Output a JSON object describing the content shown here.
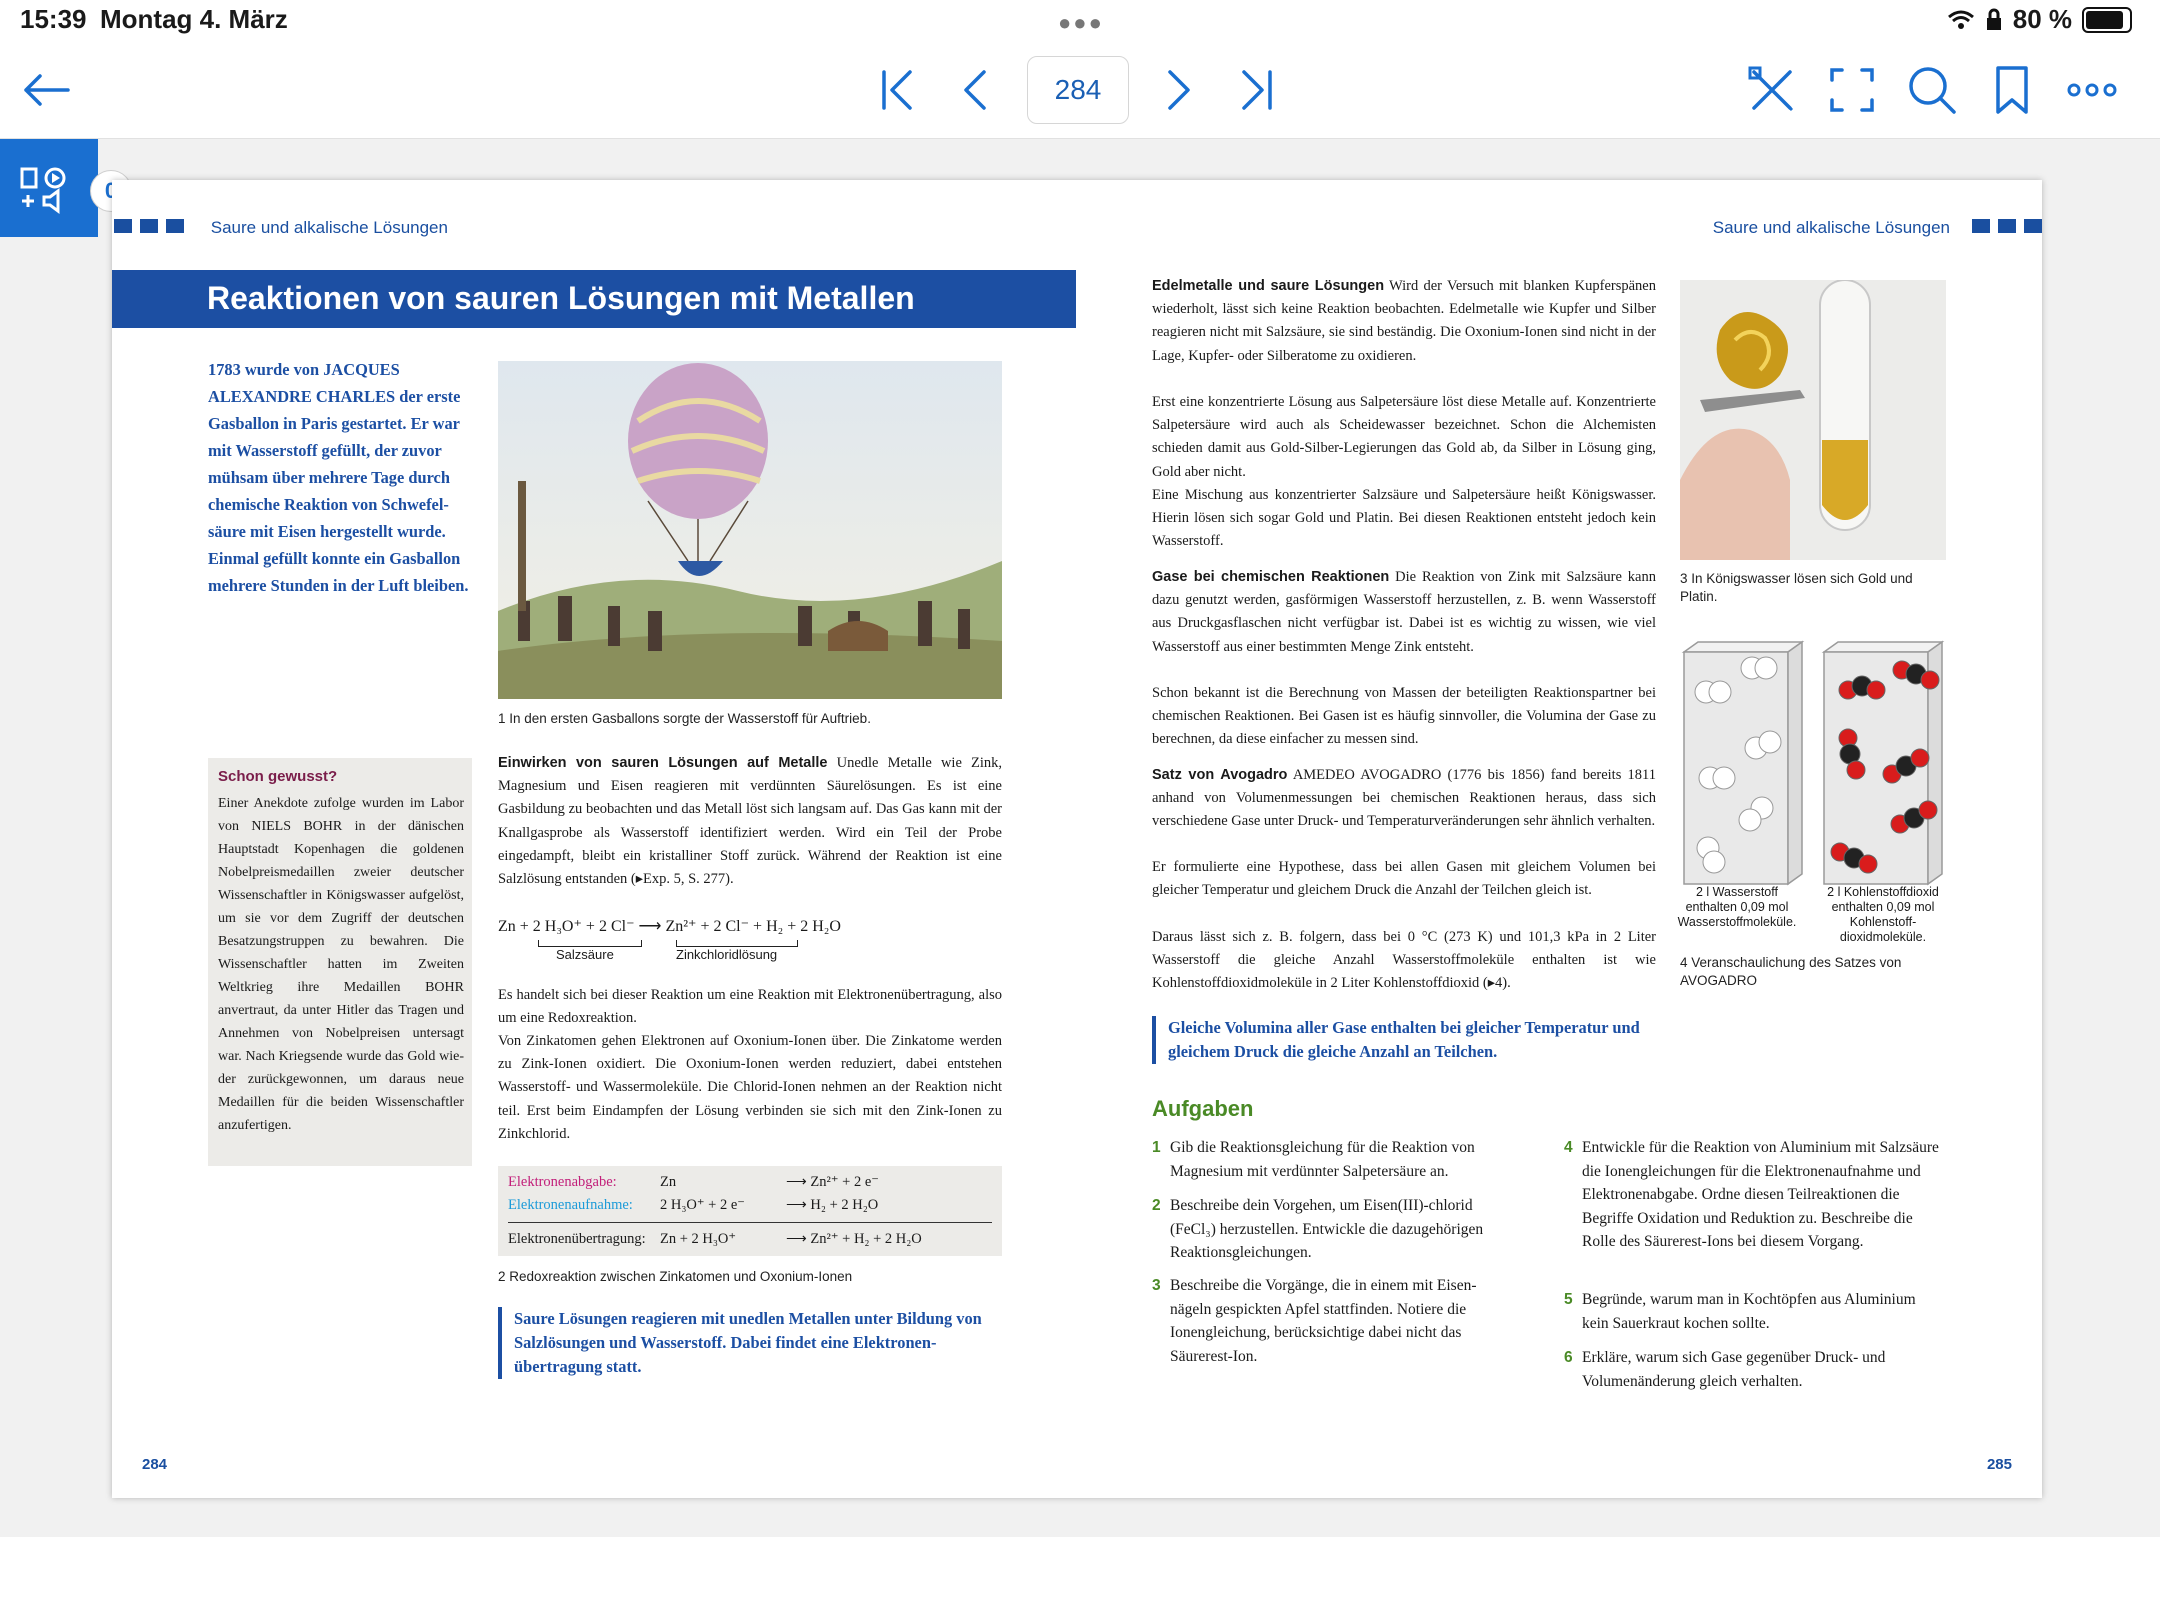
{
  "status_bar": {
    "time": "15:39",
    "date": "Montag 4. März",
    "battery": "80 %"
  },
  "toolbar": {
    "page_number": "284",
    "icons": [
      "back-arrow-icon",
      "first-page-icon",
      "prev-page-icon",
      "next-page-icon",
      "last-page-icon",
      "tools-icon",
      "fullscreen-icon",
      "search-icon",
      "bookmark-icon",
      "more-icon"
    ]
  },
  "media": {
    "counter": "0"
  },
  "left_page": {
    "running_head": "Saure und alkalische Lösungen",
    "title": "Reaktionen von sauren Lösungen mit Metallen",
    "intro": "1783 wurde von JACQUES ALEXANDRE CHARLES der erste Gasballon in Paris gestartet. Er war mit Wasserstoff gefüllt, der zuvor mühsam über mehrere Tage durch chemische Reaktion von Schwefel­säure mit Eisen hergestellt wurde. Einmal gefüllt konnte ein Gas­ballon mehrere Stunden in der Luft bleiben.",
    "know_box": {
      "heading": "Schon gewusst?",
      "text": "Einer Anekdote zufolge wurden im Labor von NIELS BOHR in der däni­schen Hauptstadt Kopenhagen die goldenen Nobelpreismedaillen zweier deutscher Wissenschaftler in Königs­wasser aufgelöst, um sie vor dem Zugriff der deutschen Besatzungs­truppen zu bewahren. Die Wissen­schaftler hatten im Zweiten Weltkrieg ihre Medaillen BOHR anvertraut, da unter Hitler das Tragen und Anneh­men von Nobelpreisen untersagt war. Nach Kriegsende wurde das Gold wie­der zurückgewonnen, um daraus neue Medaillen für die beiden Wissen­schaftler anzufertigen."
    },
    "fig1_caption": "1  In den ersten Gasballons sorgte der Wasserstoff für Auftrieb.",
    "section1_heading": "Einwirken von sauren Lösungen auf Metalle",
    "section1_text": "Unedle Metalle wie Zink, Magnesium und Eisen reagieren mit verdünnten Säurelösungen. Es ist eine Gasbildung zu beobachten und das Metall löst sich langsam auf. Das Gas kann mit der Knallgasprobe als Wasserstoff identifiziert werden. Wird ein Teil der Probe eingedampft, bleibt ein kristalliner Stoff zurück. Während der Reaktion ist eine Salzlösung entstanden (▸Exp. 5, S. 277).",
    "equation": "Zn + 2 H₃O⁺ + 2 Cl⁻ ⟶ Zn²⁺ + 2 Cl⁻ + H₂ + 2 H₂O",
    "eq_label1": "Salzsäure",
    "eq_label2": "Zinkchloridlösung",
    "section1_text2": "Es handelt sich bei dieser Reaktion um eine Reaktion mit Elektronen­übertragung, also um eine Redoxreaktion.",
    "section1_text3": "Von Zinkatomen gehen Elektronen auf Oxonium-Ionen über. Die Zink­atome werden zu Zink-Ionen oxidiert. Die Oxonium-Ionen werden re­duziert, dabei entstehen Wasserstoff- und Wassermoleküle. Die Chlorid-Ionen nehmen an der Reaktion nicht teil. Erst beim Eindampfen der Lösung verbinden sie sich mit den Zink-Ionen zu Zinkchlorid.",
    "redox": {
      "row1_label": "Elektronenabgabe:",
      "row1_left": "Zn",
      "row1_right": "⟶  Zn²⁺ + 2 e⁻",
      "row2_label": "Elektronenaufnahme:",
      "row2_left": "2 H₃O⁺ + 2 e⁻",
      "row2_right": "⟶  H₂  + 2 H₂O",
      "row3_label": "Elektronenübertragung:",
      "row3_left": "Zn       + 2 H₃O⁺",
      "row3_right": "⟶  Zn²⁺ + H₂ + 2 H₂O"
    },
    "fig2_caption": "2  Redoxreaktion zwischen Zinkatomen und Oxonium-Ionen",
    "rule": "Saure Lösungen reagieren mit unedlen Metallen unter Bildung von Salzlösungen und Wasserstoff. Dabei findet eine Elektronen­übertragung statt.",
    "page_number": "284"
  },
  "right_page": {
    "running_head": "Saure und alkalische Lösungen",
    "section2_heading": "Edelmetalle und saure Lösungen",
    "section2_text": "Wird der Versuch mit blanken Kupfer­spänen wiederholt, lässt sich keine Reaktion beobachten. Edelmetalle wie Kupfer und Silber reagieren nicht mit Salzsäure, sie sind beständig. Die Oxonium-Ionen sind nicht in der Lage, Kupfer- oder Silberatome zu oxidieren.",
    "section2_text2": "Erst eine konzentrierte Lösung aus Salpetersäure löst diese Metalle auf. Konzentrierte Salpetersäure wird auch als Scheidewasser bezeichnet. Schon die Alchemisten schieden damit aus Gold-Silber-Legierungen das Gold ab, da Silber in Lösung ging, Gold aber nicht.",
    "section2_text3": "Eine Mischung aus konzentrierter Salzsäure und Salpetersäure heißt Königswasser. Hierin lösen sich sogar Gold und Platin. Bei diesen Reak­tionen entsteht jedoch kein Wasserstoff.",
    "section3_heading": "Gase bei chemischen Reaktionen",
    "section3_text": "Die Reaktion von Zink mit Salzsäure kann dazu genutzt werden, gasförmigen Wasserstoff herzustellen, z. B. wenn Wasserstoff aus Druckgasflaschen nicht verfügbar ist. Dabei ist es wichtig zu wissen, wie viel Wasserstoff aus einer bestimmten Menge Zink entsteht.",
    "section3_text2": "Schon bekannt ist die Berechnung von Massen der beteiligten Reaktions­partner bei chemischen Reaktionen. Bei Gasen ist es häufig sinnvoller, die Volumina der Gase zu berechnen, da diese einfacher zu messen sind.",
    "section4_heading": "Satz von Avogadro",
    "section4_text": "AMEDEO AVOGADRO (1776 bis 1856) fand bereits 1811 anhand von Volumenmessungen bei chemischen Reaktionen her­aus, dass sich verschiedene Gase unter Druck- und Temperaturverände­rungen sehr ähnlich verhalten.",
    "section4_text2": "Er formulierte eine Hypothese, dass bei allen Gasen mit gleichem Volu­men bei gleicher Temperatur und gleichem Druck die Anzahl der Teil­chen gleich ist.",
    "section4_text3": "Daraus lässt sich z. B. folgern, dass bei 0 °C (273 K) und 101,3 kPa in 2 Liter Wasserstoff die gleiche Anzahl Wasserstoffmoleküle enthalten ist wie Kohlenstoffdioxidmoleküle in 2 Liter Kohlenstoffdioxid (▸4).",
    "fig3_caption": "3  In Königswasser lösen sich Gold und Platin.",
    "fig4_label1": "2 l Wasserstoff enthalten 0,09 mol Wasserstoffmoleküle.",
    "fig4_label2": "2 l Kohlenstoffdioxid enthalten 0,09 mol Kohlenstoff­dioxidmoleküle.",
    "fig4_caption": "4  Veranschaulichung des Satzes von AVOGADRO",
    "rule": "Gleiche Volumina aller Gase enthalten bei gleicher Temperatur und gleichem Druck die gleiche Anzahl an Teilchen.",
    "tasks_heading": "Aufgaben",
    "tasks": [
      {
        "n": "1",
        "text": "Gib die Reaktionsgleichung für die Reaktion von Magnesium mit verdünnter Salpetersäure an."
      },
      {
        "n": "2",
        "text": "Beschreibe dein Vorgehen, um Eisen(III)-chlorid (FeCl₃) herzustellen. Entwickle die dazugehörigen Reaktionsgleichungen."
      },
      {
        "n": "3",
        "text": "Beschreibe die Vorgänge, die in einem mit Eisen­nägeln gespickten Apfel stattfinden. Notiere die Ionengleichung, berücksichtige dabei nicht das Säurerest-Ion."
      },
      {
        "n": "4",
        "text": "Entwickle für die Reaktion von Aluminium mit Salzsäure die Ionengleichungen für die Elektronen­aufnahme und Elektronenabgabe. Ordne diesen Teilreaktionen die Begriffe Oxidation und Reduk­tion zu. Beschreibe die Rolle des Säurerest-Ions bei diesem Vorgang."
      },
      {
        "n": "5",
        "text": "Begründe, warum man in Kochtöpfen aus Alumi­nium kein Sauerkraut kochen sollte."
      },
      {
        "n": "6",
        "text": "Erkläre, warum sich Gase gegenüber Druck- und Volumenänderung gleich verhalten."
      }
    ],
    "page_number": "285"
  }
}
